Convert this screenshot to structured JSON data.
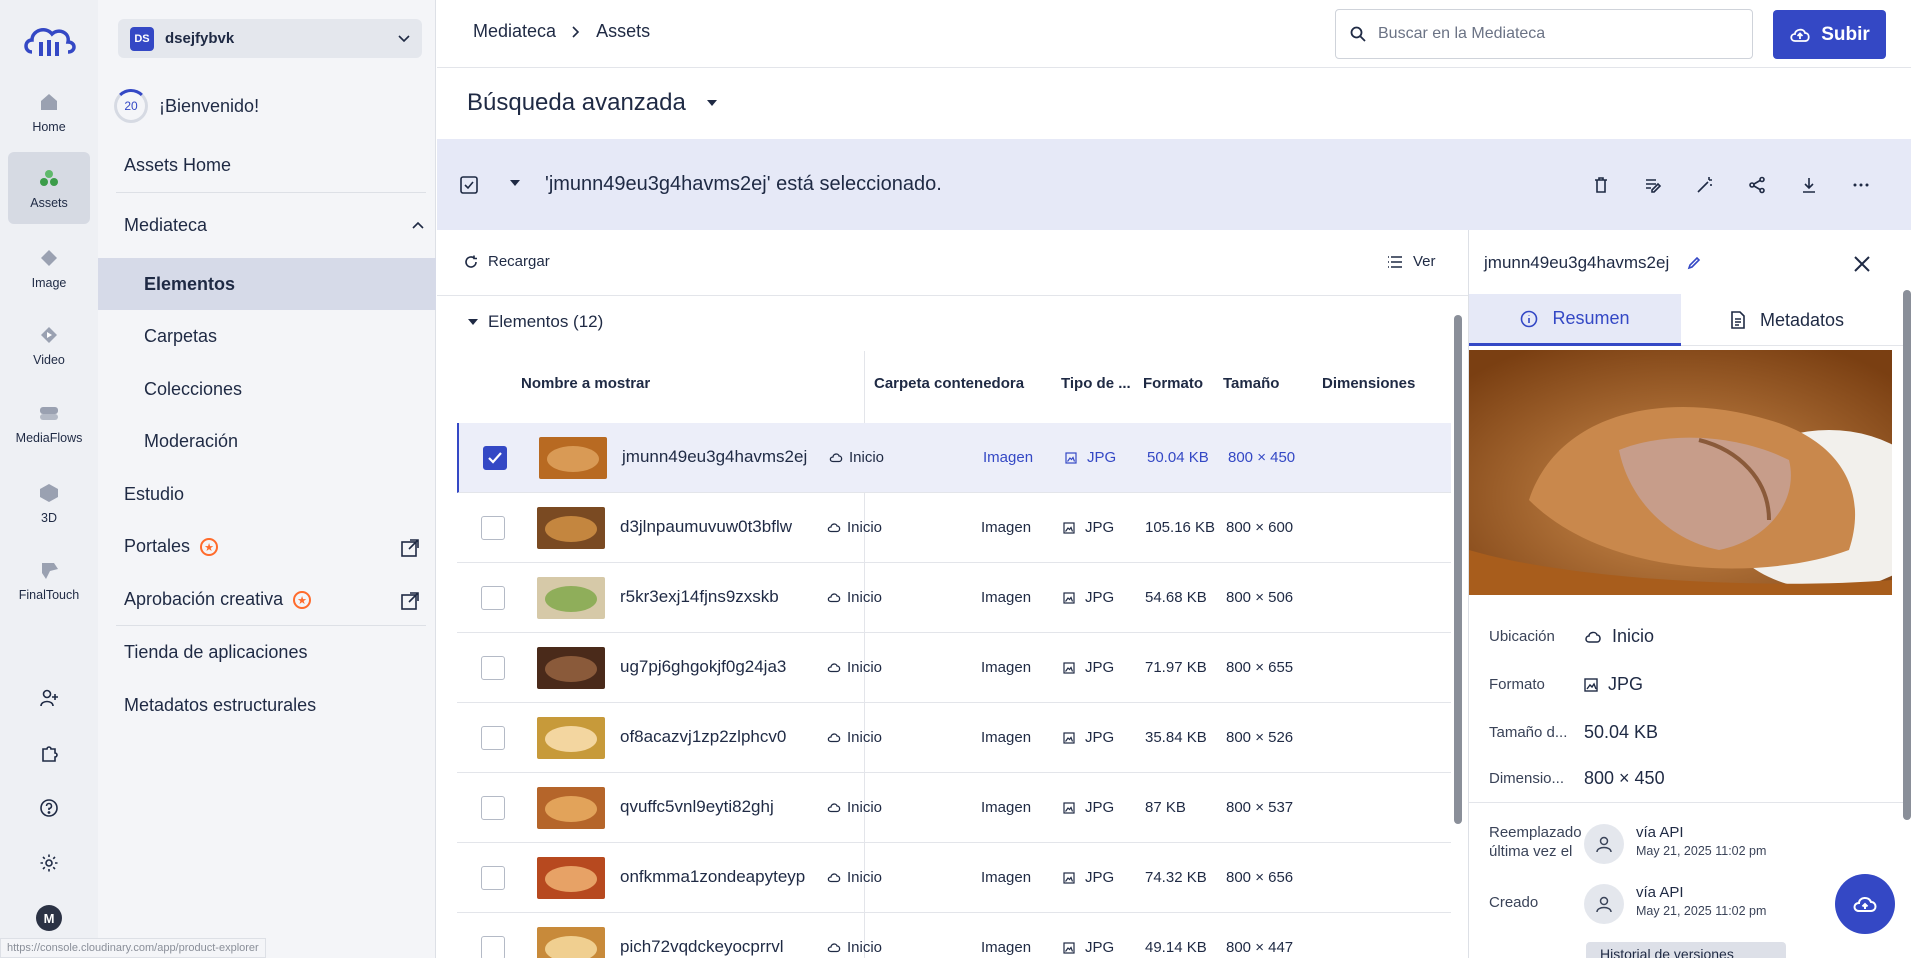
{
  "rail": {
    "items": [
      {
        "label": "Home",
        "icon": "house-icon"
      },
      {
        "label": "Assets",
        "icon": "assets-icon"
      },
      {
        "label": "Image",
        "icon": "image-icon"
      },
      {
        "label": "Video",
        "icon": "video-icon"
      },
      {
        "label": "MediaFlows",
        "icon": "mediaflows-icon"
      },
      {
        "label": "3D",
        "icon": "cube-icon"
      },
      {
        "label": "FinalTouch",
        "icon": "finaltouch-icon"
      }
    ],
    "avatar_letter": "M"
  },
  "sidebar": {
    "cloud_badge": "DS",
    "cloud_name": "dsejfybvk",
    "progress": "20",
    "welcome": "¡Bienvenido!",
    "assets_home": "Assets Home",
    "mediateca": "Mediateca",
    "sub": [
      "Elementos",
      "Carpetas",
      "Colecciones",
      "Moderación"
    ],
    "estudio": "Estudio",
    "portales": "Portales",
    "aprobacion": "Aprobación creativa",
    "tienda": "Tienda de aplicaciones",
    "metadatos": "Metadatos estructurales"
  },
  "header": {
    "crumb_root": "Mediateca",
    "crumb_leaf": "Assets",
    "search_placeholder": "Buscar en la Mediateca",
    "upload": "Subir"
  },
  "adv_search": "Búsqueda avanzada",
  "selection": {
    "message": "'jmunn49eu3g4havms2ej' está seleccionado."
  },
  "list": {
    "reload": "Recargar",
    "view": "Ver",
    "group": "Elementos (12)",
    "columns": [
      "Nombre a mostrar",
      "Carpeta contenedora",
      "Tipo de ...",
      "Formato",
      "Tamaño",
      "Dimensiones"
    ],
    "rows": [
      {
        "name": "jmunn49eu3g4havms2ej",
        "folder": "Inicio",
        "type": "Imagen",
        "format": "JPG",
        "size": "50.04 KB",
        "dims": "800 × 450",
        "selected": true
      },
      {
        "name": "d3jlnpaumuvuw0t3bflw",
        "folder": "Inicio",
        "type": "Imagen",
        "format": "JPG",
        "size": "105.16 KB",
        "dims": "800 × 600",
        "selected": false
      },
      {
        "name": "r5kr3exj14fjns9zxskb",
        "folder": "Inicio",
        "type": "Imagen",
        "format": "JPG",
        "size": "54.68 KB",
        "dims": "800 × 506",
        "selected": false
      },
      {
        "name": "ug7pj6ghgokjf0g24ja3",
        "folder": "Inicio",
        "type": "Imagen",
        "format": "JPG",
        "size": "71.97 KB",
        "dims": "800 × 655",
        "selected": false
      },
      {
        "name": "of8acazvj1zp2zlphcv0",
        "folder": "Inicio",
        "type": "Imagen",
        "format": "JPG",
        "size": "35.84 KB",
        "dims": "800 × 526",
        "selected": false
      },
      {
        "name": "qvuffc5vnl9eyti82ghj",
        "folder": "Inicio",
        "type": "Imagen",
        "format": "JPG",
        "size": "87 KB",
        "dims": "800 × 537",
        "selected": false
      },
      {
        "name": "onfkmma1zondeapyteyp",
        "folder": "Inicio",
        "type": "Imagen",
        "format": "JPG",
        "size": "74.32 KB",
        "dims": "800 × 656",
        "selected": false
      },
      {
        "name": "pich72vqdckeyocprrvl",
        "folder": "Inicio",
        "type": "Imagen",
        "format": "JPG",
        "size": "49.14 KB",
        "dims": "800 × 447",
        "selected": false
      }
    ]
  },
  "details": {
    "title": "jmunn49eu3g4havms2ej",
    "tab_summary": "Resumen",
    "tab_metadata": "Metadatos",
    "k_location": "Ubicación",
    "v_location": "Inicio",
    "k_format": "Formato",
    "v_format": "JPG",
    "k_size": "Tamaño d...",
    "v_size": "50.04 KB",
    "k_dims": "Dimensio...",
    "v_dims": "800 × 450",
    "k_replaced_1": "Reemplazado",
    "k_replaced_2": "última vez el",
    "replaced_by": "vía API",
    "replaced_at": "May 21, 2025 11:02 pm",
    "k_created": "Creado",
    "created_by": "vía API",
    "created_at": "May 21, 2025 11:02 pm",
    "history": "Historial de versiones"
  },
  "status_url": "https://console.cloudinary.com/app/product-explorer",
  "colors": {
    "accent": "#3448c5",
    "orange": "#ff6b2c"
  }
}
